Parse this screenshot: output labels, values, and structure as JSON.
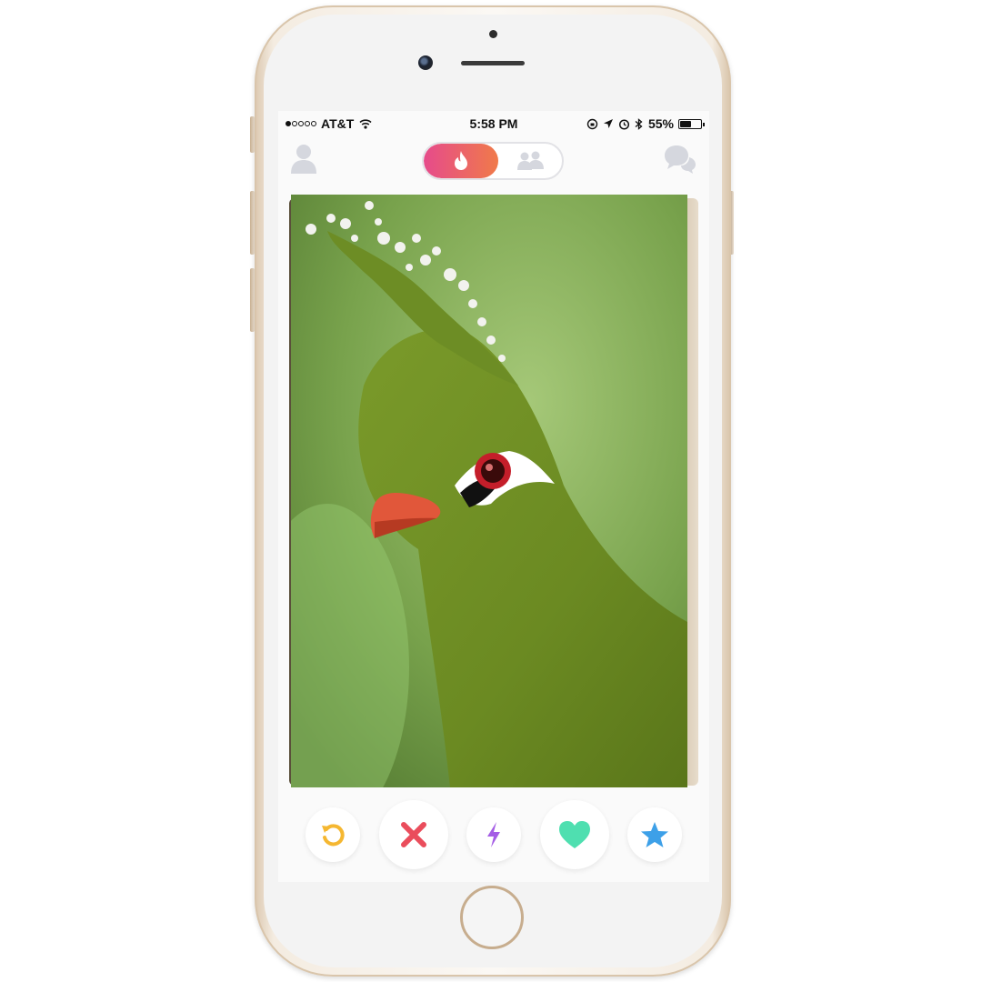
{
  "status_bar": {
    "carrier": "AT&T",
    "signal_bars": 1,
    "time": "5:58 PM",
    "battery_percent": "55%",
    "battery_level": 0.55
  },
  "nav": {
    "left_icon": "profile-icon",
    "toggle_active_icon": "flame-icon",
    "toggle_inactive_icon": "group-icon",
    "right_icon": "chat-icon"
  },
  "card": {
    "photo_subject": "green crested bird"
  },
  "actions": [
    {
      "name": "rewind",
      "icon": "rewind-icon",
      "color": "#f5b731"
    },
    {
      "name": "nope",
      "icon": "close-icon",
      "color": "#ea4d5c"
    },
    {
      "name": "boost",
      "icon": "lightning-icon",
      "color": "#a45ce5"
    },
    {
      "name": "like",
      "icon": "heart-icon",
      "color": "#4fdfb0"
    },
    {
      "name": "super-like",
      "icon": "star-icon",
      "color": "#3da0e8"
    }
  ],
  "colors": {
    "brand_gradient_start": "#e64b8b",
    "brand_gradient_end": "#f07a4a",
    "icon_gray": "#d5d7de"
  }
}
